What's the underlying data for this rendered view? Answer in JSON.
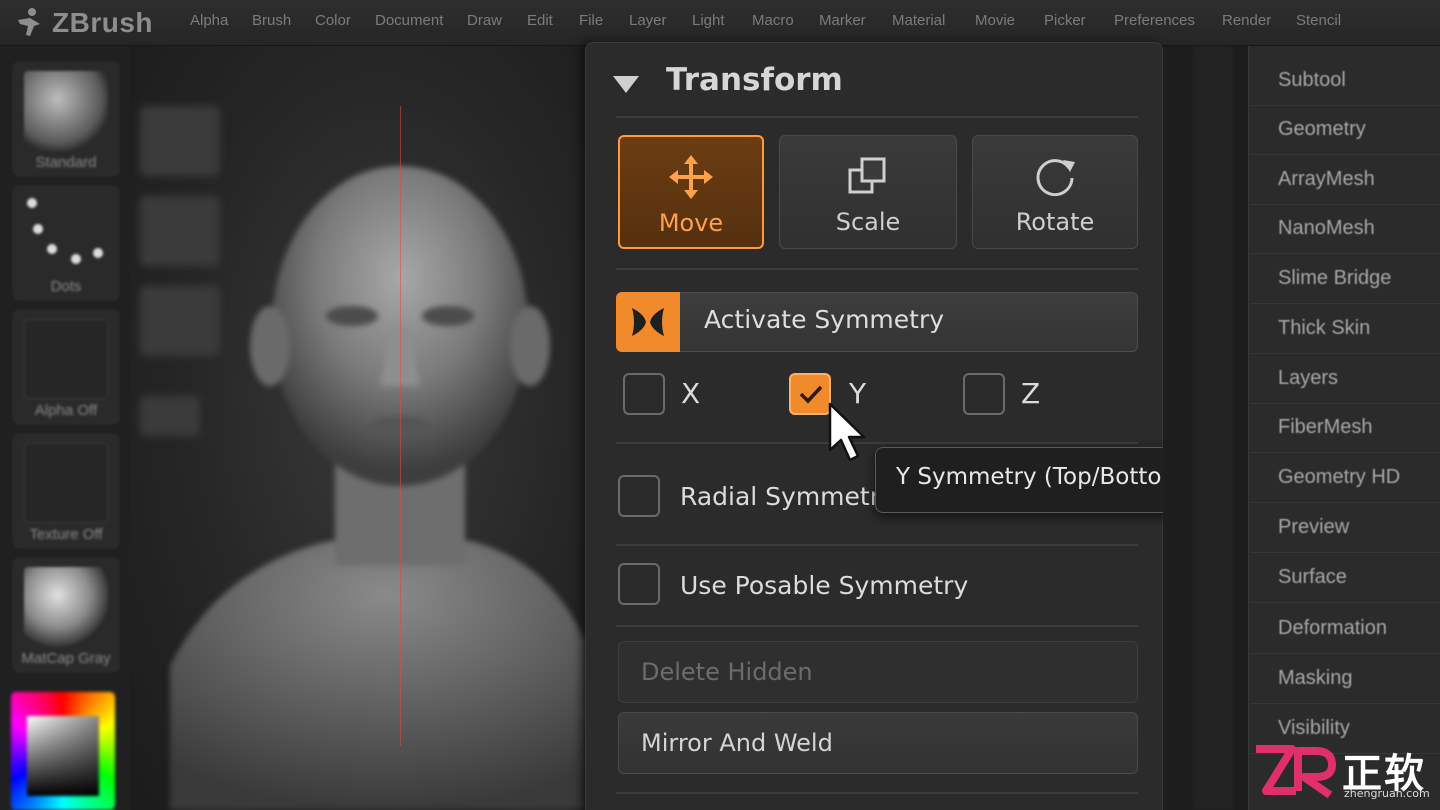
{
  "app": {
    "name": "ZBrush"
  },
  "menu": [
    "Alpha",
    "Brush",
    "Color",
    "Document",
    "Draw",
    "Edit",
    "File",
    "Layer",
    "Light",
    "Macro",
    "Marker",
    "Material",
    "Movie",
    "Picker",
    "Preferences",
    "Render",
    "Stencil"
  ],
  "shelf": {
    "tiles": [
      {
        "label": "Standard",
        "icon": "standard-brush-icon"
      },
      {
        "label": "Dots",
        "icon": "dots-stroke-icon"
      },
      {
        "label": "Alpha Off",
        "icon": "alpha-off-icon"
      },
      {
        "label": "Texture Off",
        "icon": "texture-off-icon"
      },
      {
        "label": "MatCap Gray",
        "icon": "matcap-sphere-icon"
      }
    ]
  },
  "panel": {
    "title": "Transform",
    "buttons": [
      {
        "label": "Move",
        "icon": "move-arrows-icon",
        "active": true
      },
      {
        "label": "Scale",
        "icon": "scale-icon",
        "active": false
      },
      {
        "label": "Rotate",
        "icon": "rotate-icon",
        "active": false
      }
    ],
    "symmetry": {
      "label": "Activate Symmetry",
      "icon": "symmetry-butterfly-icon",
      "active": true
    },
    "axes": [
      {
        "label": "X",
        "checked": false
      },
      {
        "label": "Y",
        "checked": true
      },
      {
        "label": "Z",
        "checked": false
      }
    ],
    "tooltip": "Y Symmetry (Top/Bottom)",
    "radial": {
      "label": "Radial Symmetry",
      "checked": false
    },
    "posable": {
      "label": "Use Posable Symmetry",
      "checked": false
    },
    "delete_hidden": {
      "label": "Delete Hidden",
      "disabled": true
    },
    "mirror_weld": {
      "label": "Mirror And Weld"
    }
  },
  "right_menu": [
    "Subtool",
    "Geometry",
    "ArrayMesh",
    "NanoMesh",
    "Slime Bridge",
    "Thick Skin",
    "Layers",
    "FiberMesh",
    "Geometry HD",
    "Preview",
    "Surface",
    "Deformation",
    "Masking",
    "Visibility"
  ],
  "watermark": {
    "text": "正软",
    "sub": "zhengruan.com"
  },
  "colors": {
    "accent": "#f08a2a",
    "accent_light": "#ffa04a",
    "panel_bg": "#2b2b2b"
  }
}
